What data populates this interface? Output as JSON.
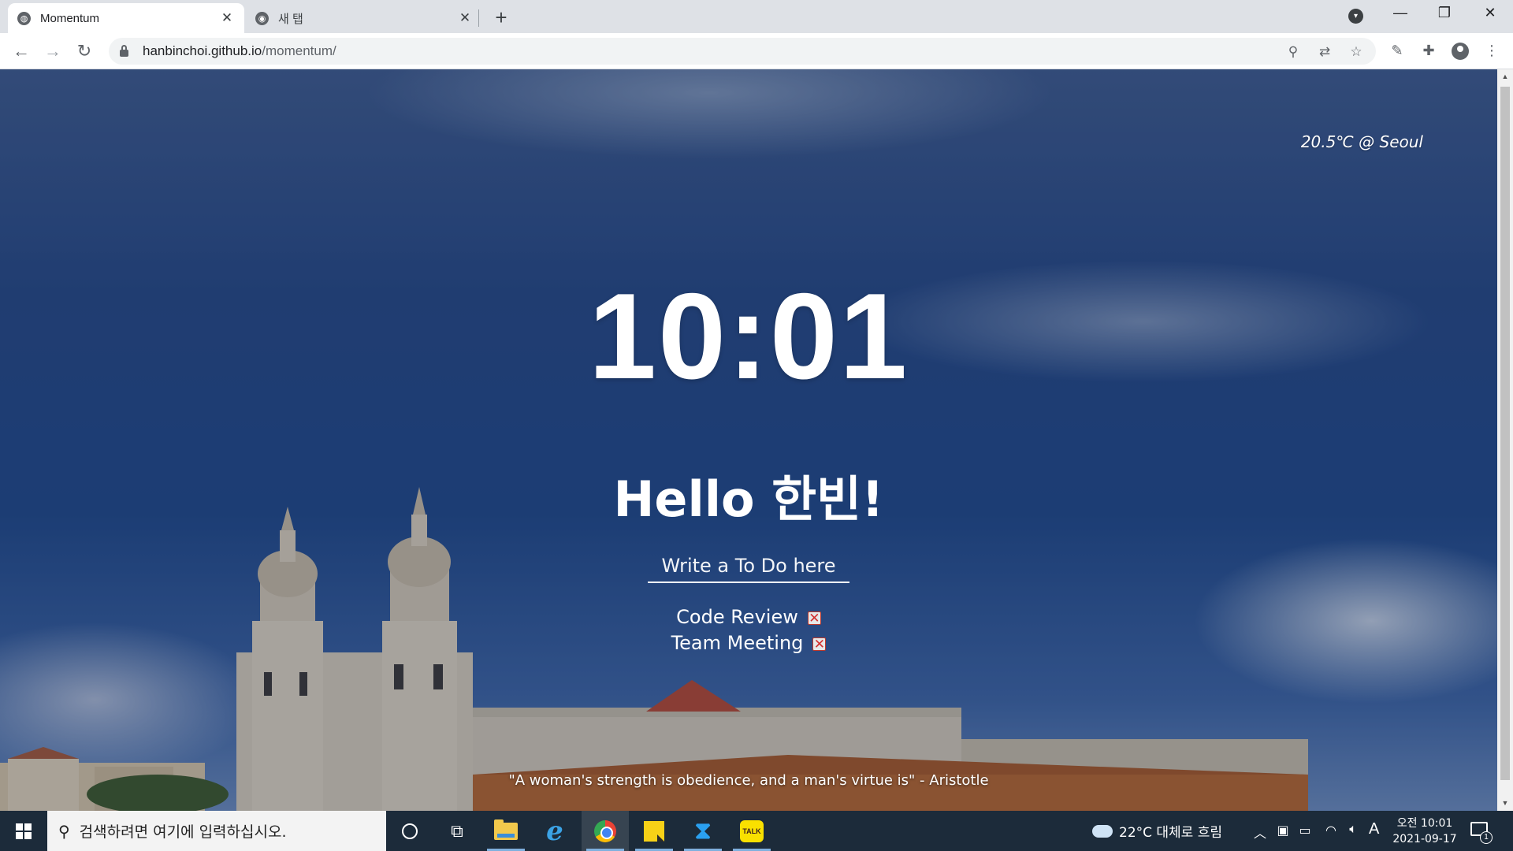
{
  "browser": {
    "tabs": [
      {
        "title": "Momentum",
        "active": true,
        "close": "✕"
      },
      {
        "title": "새 탭",
        "active": false,
        "close": "✕"
      }
    ],
    "new_tab": "+",
    "url_domain": "hanbinchoi.github.io",
    "url_path": "/momentum/",
    "nav": {
      "back": "←",
      "forward": "→",
      "reload": "↻"
    },
    "window_controls": {
      "minimize": "—",
      "maximize": "❐",
      "close": "✕"
    },
    "icons": [
      "location-pin-icon",
      "translate-icon",
      "bookmark-star-icon",
      "eyedropper-extension-icon",
      "extensions-puzzle-icon",
      "profile-avatar-icon",
      "menu-kebab-icon"
    ]
  },
  "page": {
    "weather": "20.5℃ @ Seoul",
    "clock": "10:01",
    "greeting": "Hello 한빈!",
    "todo_placeholder": "Write a To Do here",
    "todos": [
      "Code Review",
      "Team Meeting"
    ],
    "delete_label": "✕",
    "quote": "\"A woman's strength is obedience, and a man's virtue is\" - Aristotle"
  },
  "taskbar": {
    "search_placeholder": "검색하려면 여기에 입력하십시오.",
    "apps": [
      "cortana",
      "task-view",
      "file-explorer",
      "internet-explorer",
      "chrome",
      "sticky-notes",
      "vscode",
      "kakaotalk"
    ],
    "kakao_label": "TALK",
    "weather": "22°C 대체로 흐림",
    "ime": "A",
    "time": "오전 10:01",
    "date": "2021-09-17",
    "notifications": "1"
  },
  "colors": {
    "sky": "#1f4a8a",
    "taskbar": "#1c2b3a",
    "tabstrip": "#dee1e6"
  }
}
